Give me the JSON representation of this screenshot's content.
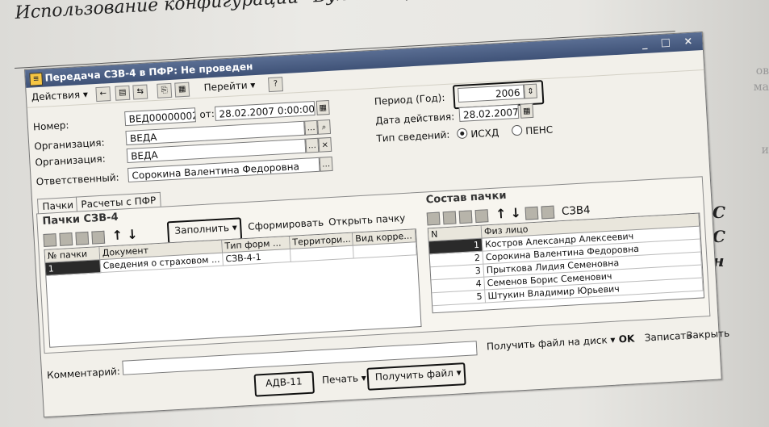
{
  "book": {
    "title": "Использование конфигурации “Бухгалтерия предприятия”",
    "side_letters": [
      "С",
      "С",
      "н"
    ],
    "side_faint": [
      "ов",
      "ма",
      "и"
    ]
  },
  "window": {
    "title": "Передача СЗВ-4 в ПФР: Не проведен",
    "controls": "_ □ ×"
  },
  "toolbar": {
    "actions": "Действия",
    "goto": "Перейти",
    "help": "?"
  },
  "form": {
    "number_label": "Номер:",
    "number_value": "ВЕД00000002",
    "from_label": "от:",
    "date_value": "28.02.2007 0:00:00",
    "org_label": "Организация:",
    "org_value": "ВЕДА",
    "resp_label": "Ответственный:",
    "resp_value": "Сорокина Валентина Федоровна",
    "period_label": "Период (Год):",
    "period_value": "2006",
    "action_date_label": "Дата действия:",
    "action_date_value": "28.02.2007",
    "info_type_label": "Тип сведений:",
    "info_type_options": [
      "ИСХД",
      "ПЕНС"
    ],
    "info_type_selected": "ИСХД"
  },
  "tabs": [
    {
      "label": "Пачки"
    },
    {
      "label": "Расчеты с ПФР"
    }
  ],
  "packs": {
    "title": "Пачки СЗВ-4",
    "fill_button": "Заполнить",
    "form_button": "Сформировать",
    "open_button": "Открыть пачку",
    "columns": [
      "№ пачки",
      "Документ",
      "Тип форм ...",
      "Территори...",
      "Вид корре..."
    ],
    "rows": [
      {
        "num": "1",
        "doc": "Сведения о страховом ...",
        "type": "СЗВ-4-1",
        "terr": "",
        "kind": ""
      }
    ]
  },
  "composition": {
    "title": "Состав пачки",
    "columns": [
      "N",
      "Физ лицо"
    ],
    "rows": [
      {
        "n": "1",
        "name": "Костров Александр Алексеевич"
      },
      {
        "n": "2",
        "name": "Сорокина Валентина Федоровна"
      },
      {
        "n": "3",
        "name": "Прыткова Лидия Семеновна"
      },
      {
        "n": "4",
        "name": "Семенов Борис Семенович"
      },
      {
        "n": "5",
        "name": "Штукин Владимир Юрьевич"
      }
    ],
    "icon_text": "СЗВ4"
  },
  "bottom": {
    "comment_label": "Комментарий:",
    "ok": "OK",
    "save": "Записать",
    "close": "Закрыть",
    "get_file_disk": "Получить файл на диск",
    "adv": "АДВ-11",
    "print": "Печать",
    "get_file": "Получить файл"
  },
  "colors": {
    "titlebar": "#3f5277",
    "highlight_border": "#111111",
    "selected_row": "#2a2a2a"
  }
}
